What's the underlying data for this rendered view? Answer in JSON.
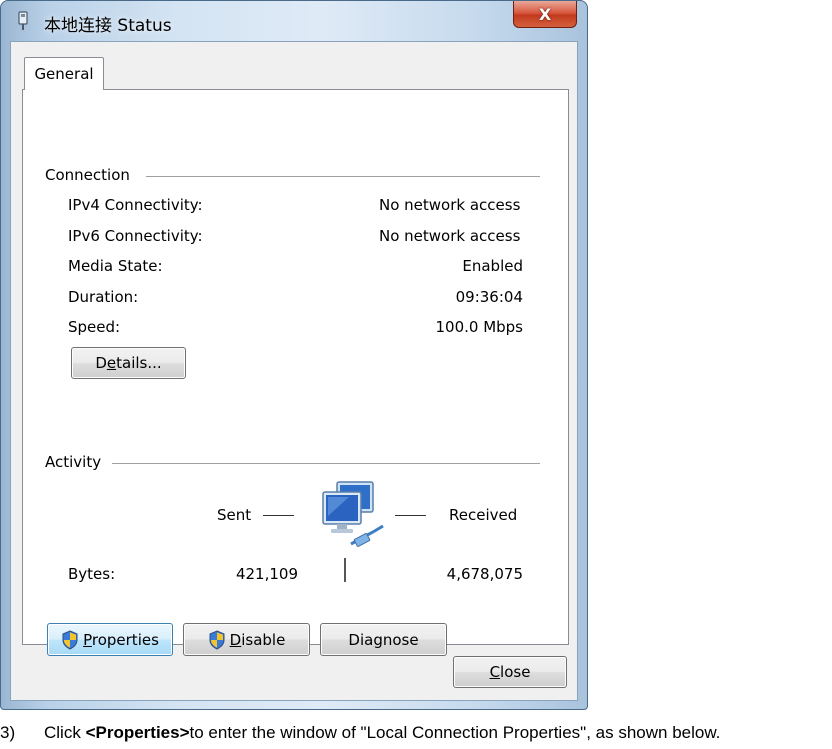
{
  "window": {
    "title": "本地连接 Status",
    "close_glyph": "X"
  },
  "tabs": [
    {
      "label": "General",
      "selected": true
    }
  ],
  "connection": {
    "group_label": "Connection",
    "rows": [
      {
        "label": "IPv4 Connectivity:",
        "value": "No network access"
      },
      {
        "label": "IPv6 Connectivity:",
        "value": "No network access"
      },
      {
        "label": "Media State:",
        "value": "Enabled"
      },
      {
        "label": "Duration:",
        "value": "09:36:04"
      },
      {
        "label": "Speed:",
        "value": "100.0 Mbps"
      }
    ],
    "details_button": {
      "pre": "D",
      "accel": "e",
      "post": "tails..."
    }
  },
  "activity": {
    "group_label": "Activity",
    "sent_label": "Sent",
    "received_label": "Received",
    "bytes_label": "Bytes:",
    "sent_bytes": "421,109",
    "received_bytes": "4,678,075",
    "icon": "network-computers-icon"
  },
  "buttons": {
    "properties": {
      "accel": "P",
      "post": "roperties",
      "focused": true
    },
    "disable": {
      "accel": "D",
      "post": "isable"
    },
    "diagnose": {
      "pre": "Dia",
      "accel": "g",
      "post": "nose"
    },
    "close": {
      "accel": "C",
      "post": "lose"
    }
  },
  "caption": {
    "number": "3)",
    "text_before": "Click ",
    "bold": "<Properties>",
    "text_after": "to enter the window of \"Local Connection Properties\", as shown below."
  },
  "colors": {
    "titlebar": "#c9dcef",
    "close_button": "#c9452a",
    "focused_button": "#bee6fd",
    "panel": "#ffffff"
  }
}
